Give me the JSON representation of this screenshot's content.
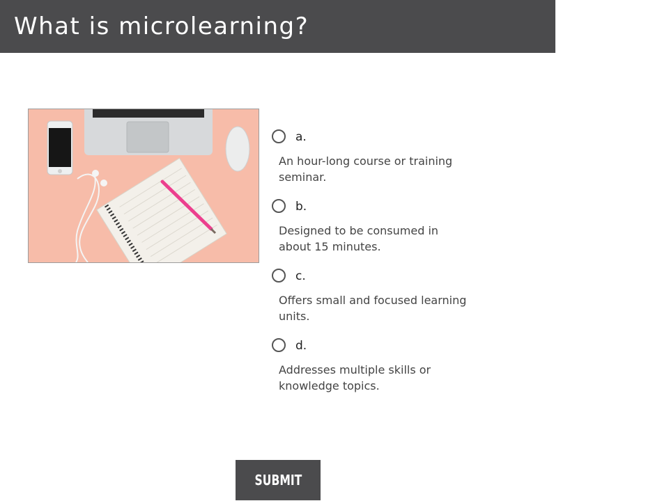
{
  "header": {
    "title": "What is microlearning?"
  },
  "image": {
    "description_icon": "desk-photo"
  },
  "question": {
    "options": [
      {
        "letter": "a.",
        "text": "An hour-long course or training seminar."
      },
      {
        "letter": "b.",
        "text": "Designed to be consumed in about 15 minutes."
      },
      {
        "letter": "c.",
        "text": "Offers small and focused learning units."
      },
      {
        "letter": "d.",
        "text": "Addresses multiple skills or knowledge topics."
      }
    ]
  },
  "submit": {
    "label": "SUBMIT"
  },
  "colors": {
    "header_bg": "#4b4b4d",
    "photo_bg": "#f7bca9",
    "button_bg": "#4b4b4d"
  }
}
